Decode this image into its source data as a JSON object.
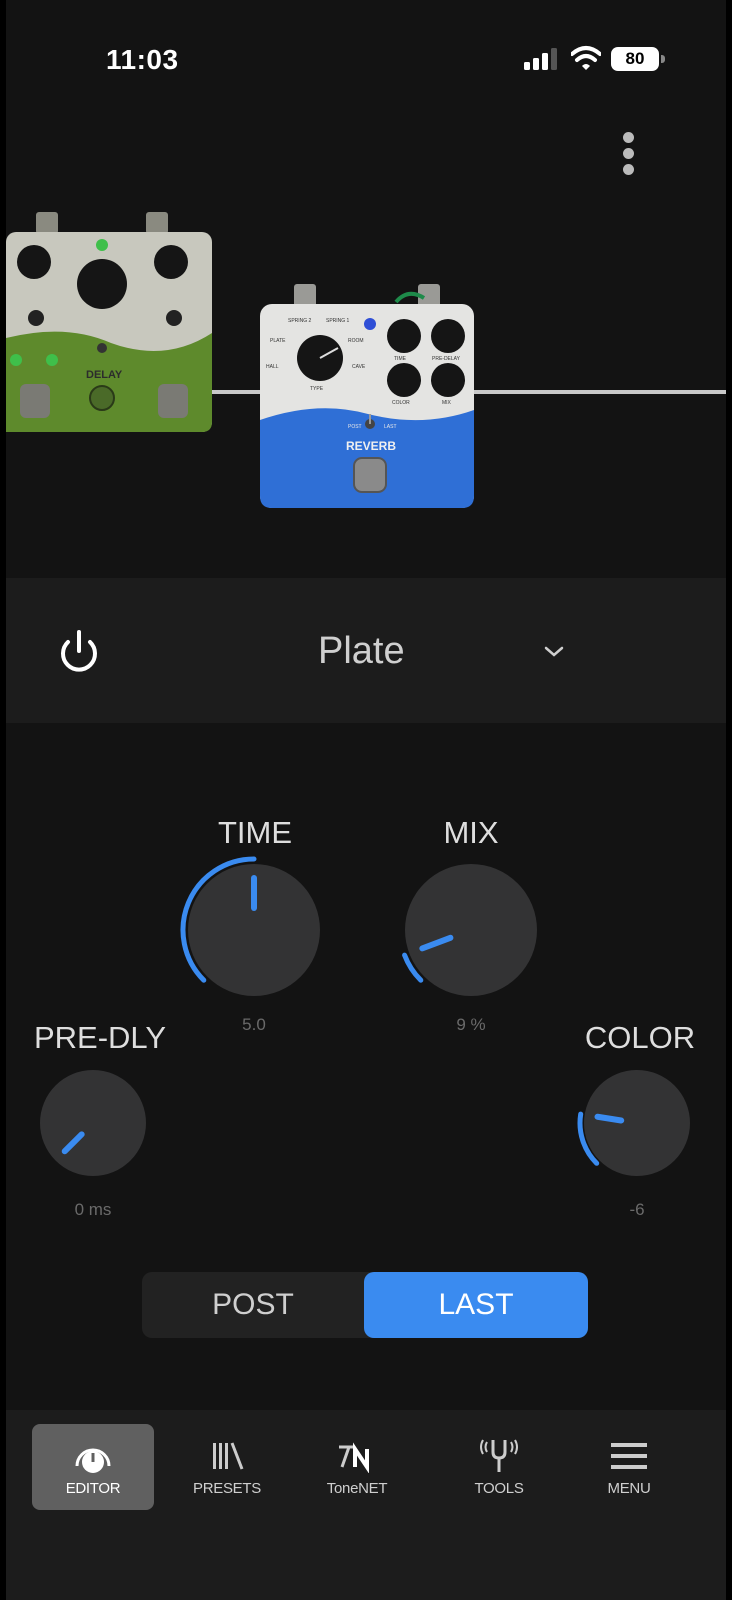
{
  "status_bar": {
    "time": "11:03",
    "battery": "80"
  },
  "pedals": {
    "delay": {
      "name": "DELAY"
    },
    "reverb": {
      "name": "REVERB",
      "labels": {
        "type": "TYPE",
        "time": "TIME",
        "pre_delay": "PRE-DELAY",
        "color": "COLOR",
        "mix": "MIX",
        "post": "POST",
        "last": "LAST",
        "spring1": "SPRING 1",
        "spring2": "SPRING 2",
        "plate": "PLATE",
        "room": "ROOM",
        "hall": "HALL",
        "cave": "CAVE"
      }
    }
  },
  "selector": {
    "preset": "Plate"
  },
  "knobs": {
    "time": {
      "label": "TIME",
      "value": "5.0",
      "level": 0.5
    },
    "mix": {
      "label": "MIX",
      "value": "9 %",
      "level": 0.09
    },
    "pre_dly": {
      "label": "PRE-DLY",
      "value": "0 ms",
      "level": 0.0
    },
    "color": {
      "label": "COLOR",
      "value": "-6",
      "level": 0.2
    }
  },
  "toggle": {
    "post": "POST",
    "last": "LAST",
    "selected": "LAST"
  },
  "nav": {
    "items": [
      {
        "label": "EDITOR",
        "icon": "editor-icon"
      },
      {
        "label": "PRESETS",
        "icon": "presets-icon"
      },
      {
        "label": "ToneNET",
        "icon": "tonenet-icon"
      },
      {
        "label": "TOOLS",
        "icon": "tools-icon"
      },
      {
        "label": "MENU",
        "icon": "menu-icon"
      }
    ]
  },
  "colors": {
    "accent": "#3a8bf0",
    "background": "#131313",
    "panel": "#1c1c1c"
  }
}
